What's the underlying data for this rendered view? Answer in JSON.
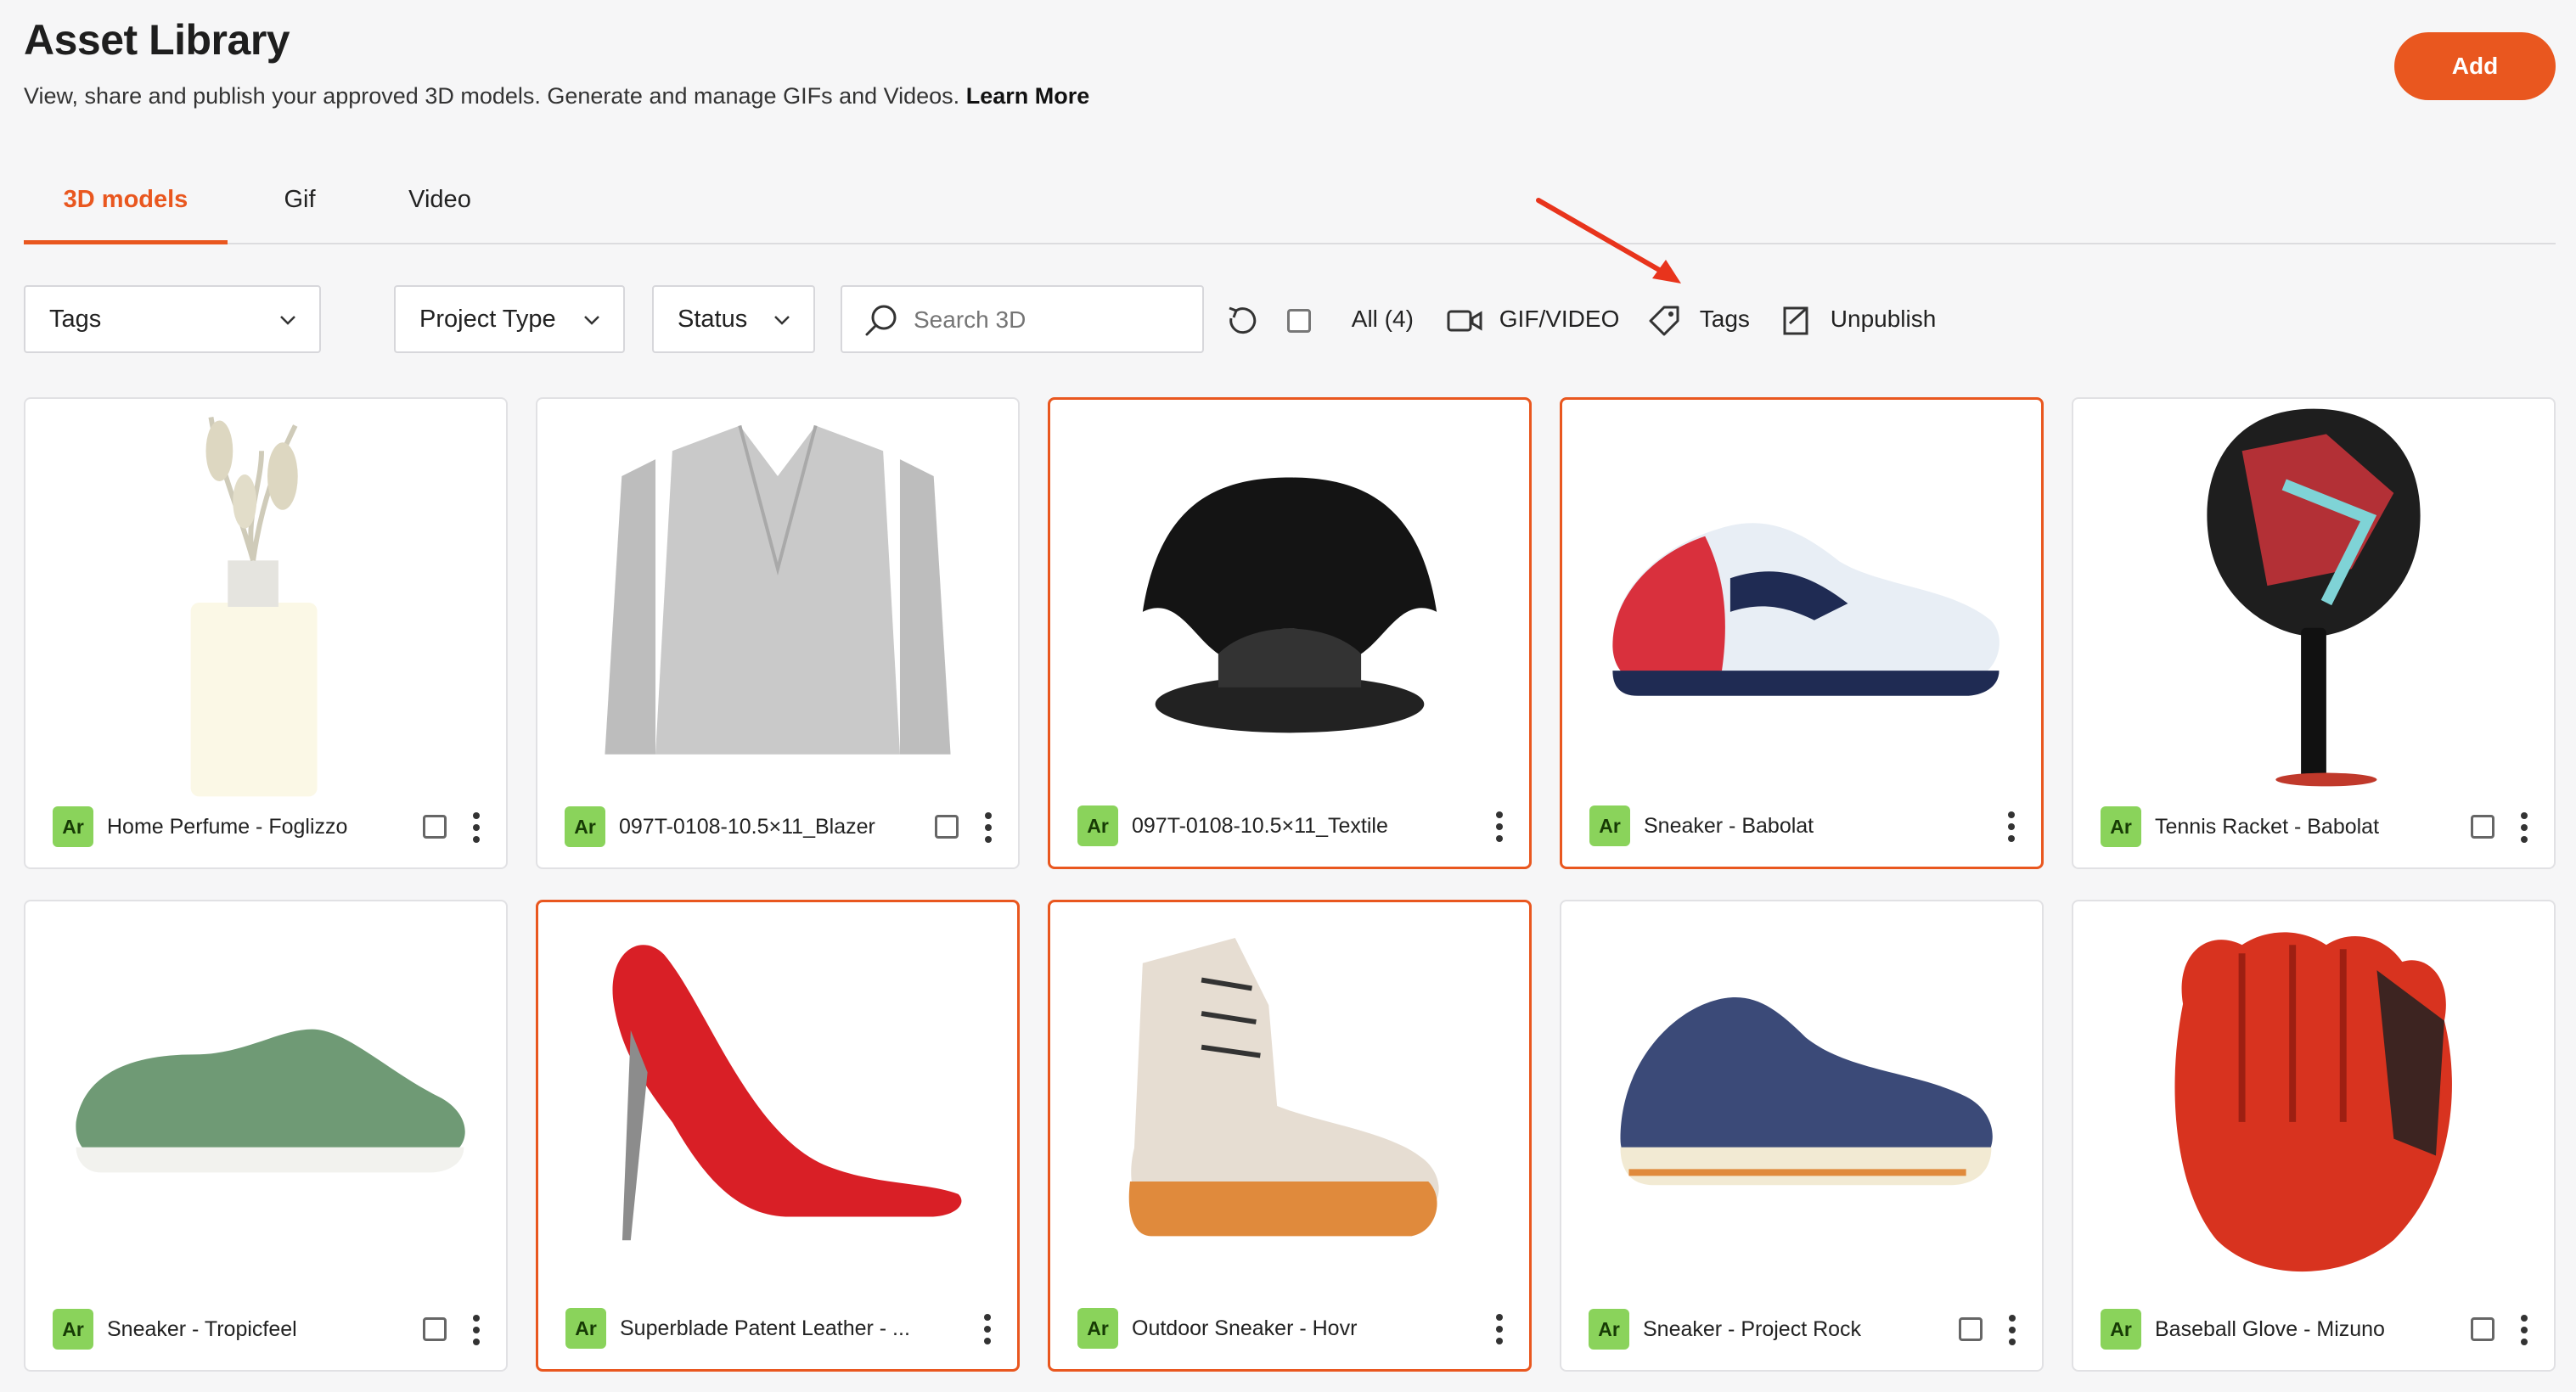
{
  "header": {
    "title": "Asset Library",
    "subtitle": "View, share and publish your approved 3D models. Generate and manage GIFs and Videos.",
    "learn_more": "Learn More",
    "add_label": "Add"
  },
  "tabs": [
    {
      "label": "3D models",
      "active": true
    },
    {
      "label": "Gif",
      "active": false
    },
    {
      "label": "Video",
      "active": false
    }
  ],
  "filters": {
    "tags_label": "Tags",
    "project_type_label": "Project Type",
    "status_label": "Status",
    "search_placeholder": "Search 3D"
  },
  "actions": {
    "all_label": "All (4)",
    "gif_video_label": "GIF/VIDEO",
    "tags_label": "Tags",
    "unpublish_label": "Unpublish"
  },
  "accent_color": "#e9571f",
  "badge_text": "Ar",
  "assets": [
    {
      "name": "Home Perfume - Foglizzo",
      "selected": false,
      "icon": "vase"
    },
    {
      "name": "097T-0108-10.5×11_Blazer",
      "selected": false,
      "icon": "blazer"
    },
    {
      "name": "097T-0108-10.5×11_Textile",
      "selected": true,
      "icon": "textile"
    },
    {
      "name": "Sneaker - Babolat",
      "selected": true,
      "icon": "sneaker-white"
    },
    {
      "name": "Tennis Racket - Babolat",
      "selected": false,
      "icon": "racket"
    },
    {
      "name": "Sneaker - Tropicfeel",
      "selected": false,
      "icon": "sneaker-green"
    },
    {
      "name": "Superblade Patent Leather - ...",
      "selected": true,
      "icon": "heel"
    },
    {
      "name": "Outdoor Sneaker - Hovr",
      "selected": true,
      "icon": "boot"
    },
    {
      "name": "Sneaker - Project Rock",
      "selected": false,
      "icon": "sneaker-navy"
    },
    {
      "name": "Baseball Glove - Mizuno",
      "selected": false,
      "icon": "glove"
    }
  ]
}
